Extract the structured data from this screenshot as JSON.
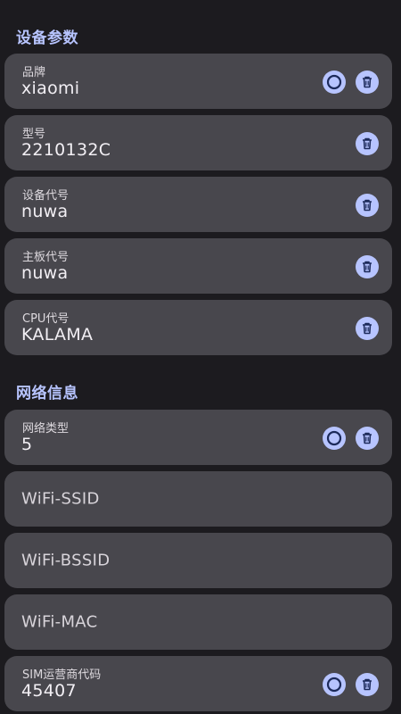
{
  "sections": {
    "device_params": "设备参数",
    "network_info": "网络信息"
  },
  "device": {
    "brand": {
      "label": "品牌",
      "value": "xiaomi"
    },
    "model": {
      "label": "型号",
      "value": "2210132C"
    },
    "device_code": {
      "label": "设备代号",
      "value": "nuwa"
    },
    "board_code": {
      "label": "主板代号",
      "value": "nuwa"
    },
    "cpu_code": {
      "label": "CPU代号",
      "value": "KALAMA"
    }
  },
  "network": {
    "net_type": {
      "label": "网络类型",
      "value": "5"
    },
    "wifi_ssid": {
      "placeholder": "WiFi-SSID"
    },
    "wifi_bssid": {
      "placeholder": "WiFi-BSSID"
    },
    "wifi_mac": {
      "placeholder": "WiFi-MAC"
    },
    "sim_operator": {
      "label": "SIM运营商代码",
      "value": "45407"
    }
  },
  "icons": {
    "circle": "circle-icon",
    "delete": "trash-icon"
  },
  "colors": {
    "background": "#1c1b1f",
    "card": "#48474d",
    "accent": "#b7c4ff"
  }
}
